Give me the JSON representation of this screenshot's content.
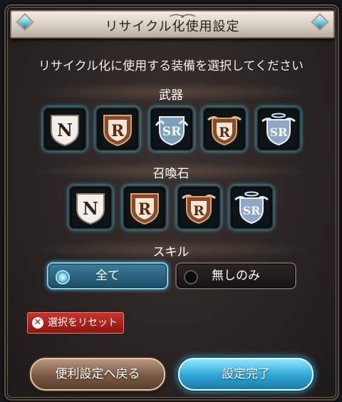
{
  "dialog": {
    "title": "リサイクル化使用設定",
    "subtitle": "リサイクル化に使用する装備を選択してください"
  },
  "weapons": {
    "label": "武器",
    "items": [
      {
        "rarity": "N",
        "selected": true
      },
      {
        "rarity": "R",
        "selected": true
      },
      {
        "rarity": "SR",
        "selected": true
      },
      {
        "rarity": "R",
        "selected": true
      },
      {
        "rarity": "SR",
        "selected": true
      }
    ]
  },
  "summons": {
    "label": "召喚石",
    "items": [
      {
        "rarity": "N",
        "selected": true
      },
      {
        "rarity": "R",
        "selected": true
      },
      {
        "rarity": "R",
        "selected": true
      },
      {
        "rarity": "SR",
        "selected": true
      }
    ]
  },
  "skill": {
    "label": "スキル",
    "options": [
      {
        "label": "全て",
        "selected": true
      },
      {
        "label": "無しのみ",
        "selected": false
      }
    ]
  },
  "reset_button": {
    "icon": "x-circle-icon",
    "label": "選択をリセット"
  },
  "footer": {
    "back_label": "便利設定へ戻る",
    "done_label": "設定完了"
  },
  "colors": {
    "accent_glow": "#4fc4e3",
    "reset_red": "#b71c14",
    "title_plate": "#e6ded5"
  }
}
